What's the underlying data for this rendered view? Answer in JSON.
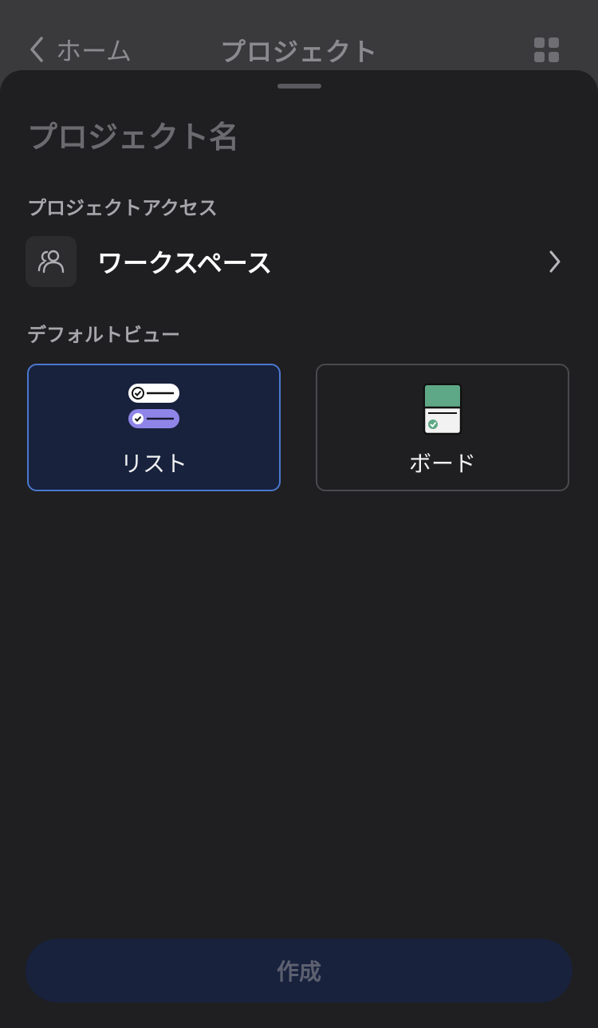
{
  "nav": {
    "back_label": "ホーム",
    "title": "プロジェクト",
    "back_icon": "chevron-left-icon",
    "menu_icon": "grid-icon"
  },
  "form": {
    "name_placeholder": "プロジェクト名",
    "name_value": "",
    "access_heading": "プロジェクトアクセス",
    "access_value": "ワークスペース",
    "access_icon": "people-icon",
    "view_heading": "デフォルトビュー",
    "views": [
      {
        "label": "リスト",
        "icon": "list-view-icon",
        "selected": true
      },
      {
        "label": "ボード",
        "icon": "board-view-icon",
        "selected": false
      }
    ],
    "submit_label": "作成"
  },
  "colors": {
    "sheet_bg": "#1f1f21",
    "selected_bg": "#18223d",
    "selected_border": "#4a78d0",
    "list_accent": "#8f85e8",
    "board_accent": "#5fa887"
  }
}
